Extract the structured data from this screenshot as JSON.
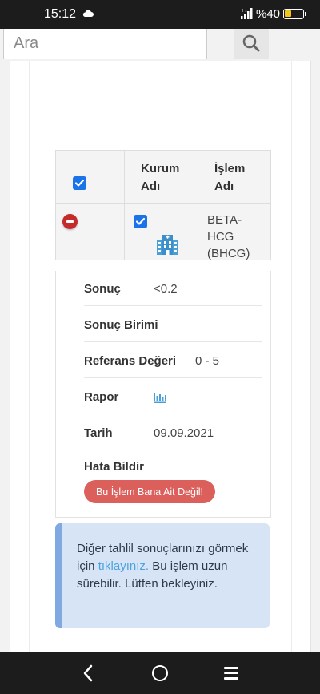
{
  "status_bar": {
    "time": "15:12",
    "battery": "%40",
    "icons": [
      "cloud-icon",
      "signal-icon",
      "battery-icon"
    ]
  },
  "search": {
    "placeholder": "Ara",
    "button_icon": "search-icon"
  },
  "table": {
    "headers": {
      "kurum": "Kurum Adı",
      "islem": "İşlem Adı"
    },
    "row": {
      "islem_name": "BETA-HCG (BHCG)",
      "institution_icon": "hospital-icon"
    }
  },
  "details": [
    {
      "label": "Sonuç",
      "value": "<0.2"
    },
    {
      "label": "Sonuç Birimi",
      "value": ""
    },
    {
      "label": "Referans Değeri",
      "value": "0 - 5"
    },
    {
      "label": "Rapor",
      "value": "",
      "icon": "bar-chart-icon"
    },
    {
      "label": "Tarih",
      "value": "09.09.2021"
    }
  ],
  "error": {
    "title": "Hata Bildir",
    "button": "Bu İşlem Bana Ait Değil!"
  },
  "info": {
    "text_before": "Diğer tahlil sonuçlarınızı görmek için",
    "link": "tıklayınız.",
    "text_after": "Bu işlem uzun sürebilir. Lütfen bekleyiniz."
  },
  "colors": {
    "checkbox": "#1a73e8",
    "danger": "#c62b2b",
    "error_button": "#d9534f",
    "info_bg": "#d6e4f6",
    "info_border": "#7fa9e0",
    "link": "#4aa3df",
    "icon_blue": "#4a9fd8"
  },
  "nav": {
    "icons": [
      "back-icon",
      "home-icon",
      "menu-icon"
    ]
  }
}
